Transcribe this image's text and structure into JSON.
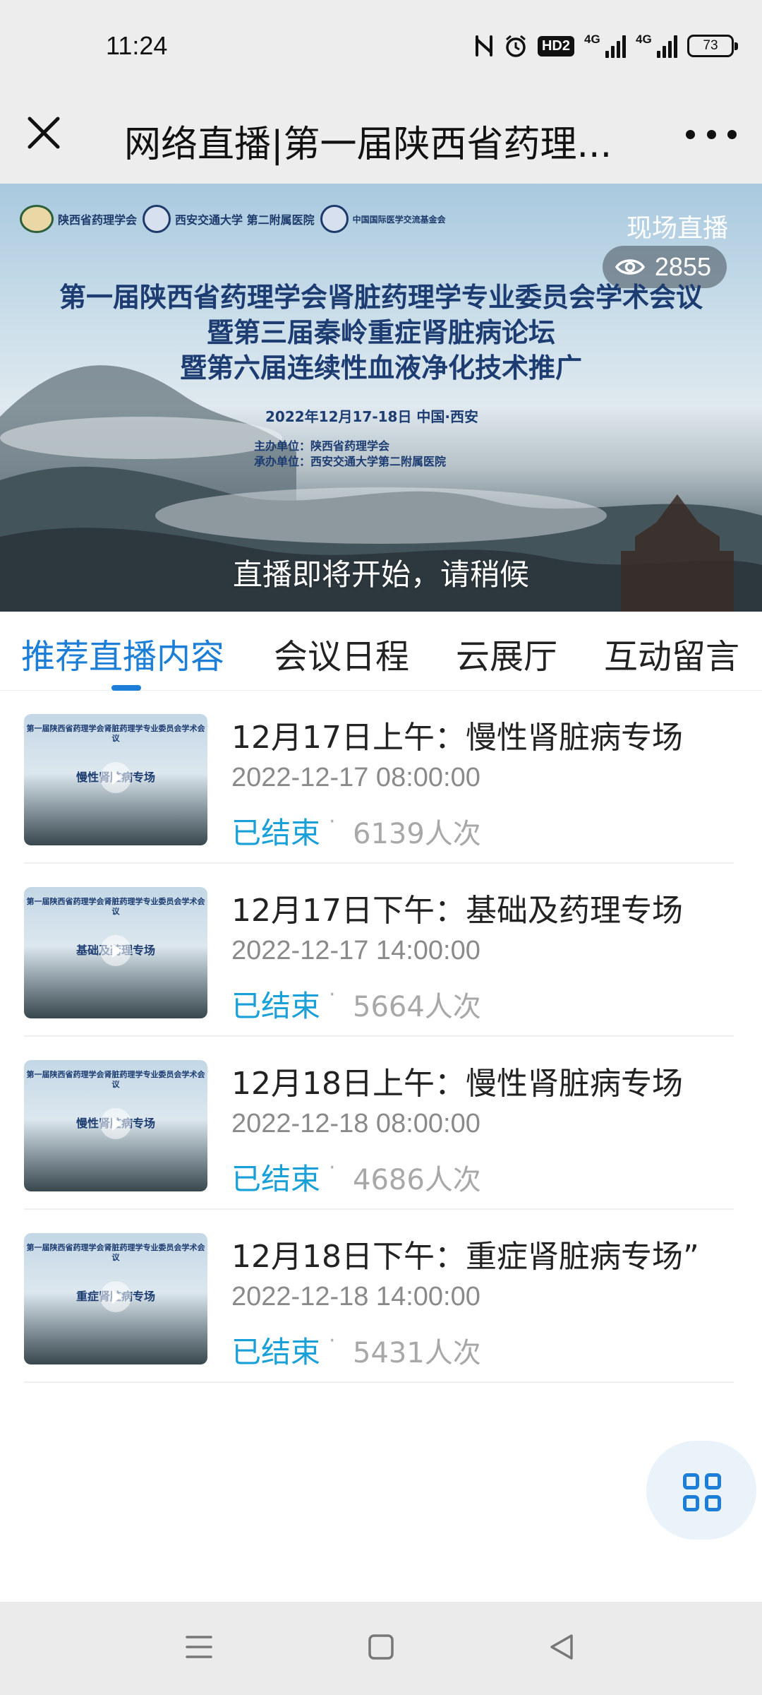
{
  "status_bar": {
    "time": "11:24",
    "hd_label": "HD2",
    "sim1_label": "4G",
    "sim2_label": "4G",
    "battery": "73"
  },
  "nav": {
    "title": "网络直播|第一届陕西省药理..."
  },
  "banner": {
    "logos": [
      "陕西省药理学会",
      "西安交通大学 第二附属医院",
      "中国国际医学交流基金会"
    ],
    "live_tag": "现场直播",
    "viewer_count": "2855",
    "title_lines": [
      "第一届陕西省药理学会肾脏药理学专业委员会学术会议",
      "暨第三届秦岭重症肾脏病论坛",
      "暨第六届连续性血液净化技术推广"
    ],
    "date_line": "2022年12月17-18日   中国·西安",
    "host": "主办单位：陕西省药理学会",
    "organizer": "承办单位：西安交通大学第二附属医院",
    "waiting_text": "直播即将开始，请稍候"
  },
  "tabs": [
    {
      "label": "推荐直播内容",
      "active": true
    },
    {
      "label": "会议日程",
      "active": false
    },
    {
      "label": "云展厅",
      "active": false
    },
    {
      "label": "互动留言",
      "active": false
    }
  ],
  "list": [
    {
      "title": "12月17日上午：慢性肾脏病专场",
      "time": "2022-12-17 08:00:00",
      "status": "已结束",
      "views": "6139人次",
      "thumb_label": "慢性肾脏病专场"
    },
    {
      "title": "12月17日下午：基础及药理专场",
      "time": "2022-12-17 14:00:00",
      "status": "已结束",
      "views": "5664人次",
      "thumb_label": "基础及药理专场"
    },
    {
      "title": "12月18日上午：慢性肾脏病专场",
      "time": "2022-12-18 08:00:00",
      "status": "已结束",
      "views": "4686人次",
      "thumb_label": "慢性肾脏病专场"
    },
    {
      "title": "12月18日下午：重症肾脏病专场”",
      "time": "2022-12-18 14:00:00",
      "status": "已结束",
      "views": "5431人次",
      "thumb_label": "重症肾脏病专场"
    }
  ],
  "colors": {
    "accent": "#1c7ed6",
    "status_ended": "#1aa0d8",
    "banner_text": "#1c3c72"
  },
  "icons": {
    "close": "close-icon",
    "more": "more-dots-icon",
    "eye": "eye-icon",
    "play": "play-icon",
    "apps_grid": "apps-grid-icon",
    "sys_menu": "menu-icon",
    "sys_home": "home-square-icon",
    "sys_back": "back-triangle-icon"
  }
}
